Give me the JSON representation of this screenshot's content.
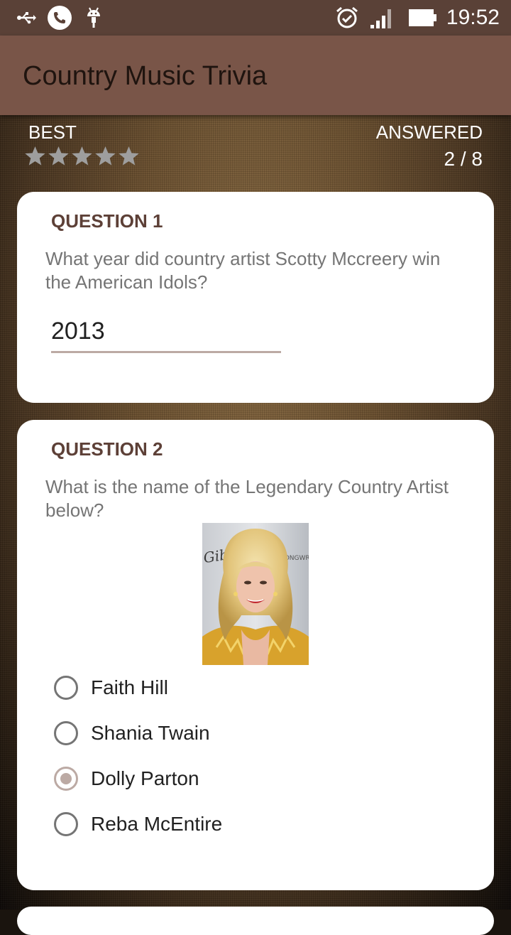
{
  "status_bar": {
    "time": "19:52",
    "icons": [
      "usb-icon",
      "phone-icon",
      "android-icon",
      "alarm-icon",
      "signal-icon",
      "battery-icon"
    ]
  },
  "app": {
    "title": "Country Music Trivia"
  },
  "score": {
    "best_label": "BEST",
    "stars_total": 5,
    "stars_filled": 0,
    "answered_label": "ANSWERED",
    "answered_count": "2 / 8"
  },
  "questions": [
    {
      "title": "QUESTION 1",
      "text": "What year did country artist Scotty Mccreery win the American Idols?",
      "answer_value": "2013"
    },
    {
      "title": "QUESTION 2",
      "text": "What is the name of the Legendary Country Artist below?",
      "photo_text_left": "Gibs",
      "photo_text_right": "SONGWR ALL",
      "options": [
        "Faith Hill",
        "Shania Twain",
        "Dolly Parton",
        "Reba McEntire"
      ],
      "selected_index": 2
    }
  ],
  "colors": {
    "status_bar": "#5a4137",
    "toolbar": "#795548",
    "question_title": "#5d4037",
    "accent_light": "#bcaaa4"
  }
}
